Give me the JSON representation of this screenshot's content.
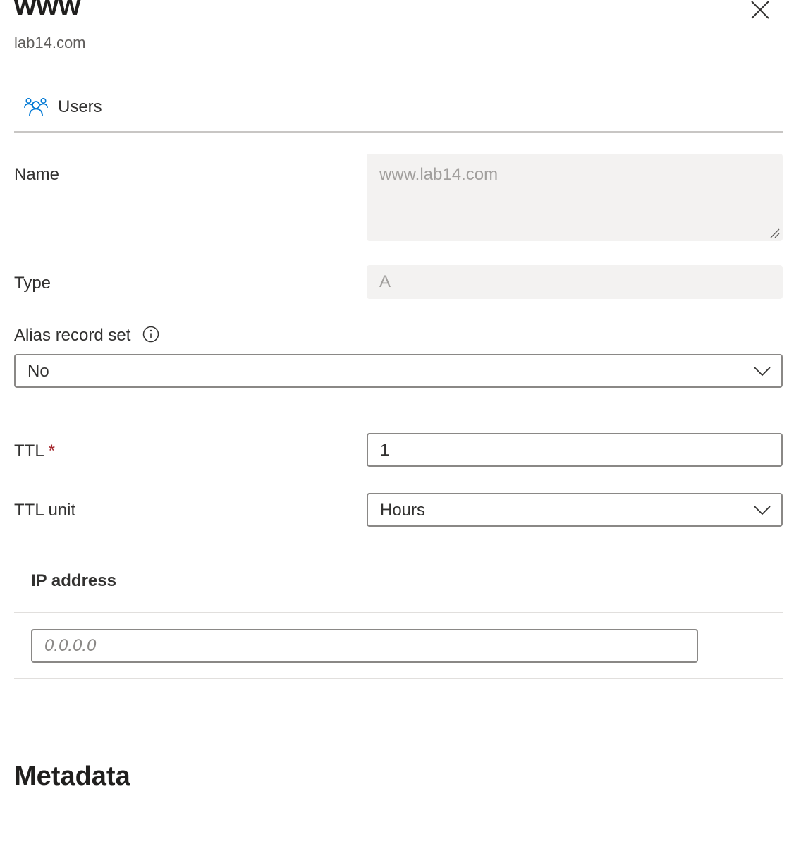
{
  "header": {
    "title": "www",
    "subtitle": "lab14.com",
    "close_icon": "close-icon"
  },
  "toolbar": {
    "users_label": "Users",
    "users_icon": "users-icon"
  },
  "form": {
    "name": {
      "label": "Name",
      "value": "www.lab14.com"
    },
    "type": {
      "label": "Type",
      "value": "A"
    },
    "alias": {
      "label": "Alias record set",
      "value": "No",
      "info_icon": "info-icon"
    },
    "ttl": {
      "label": "TTL",
      "required_mark": "*",
      "value": "1"
    },
    "ttl_unit": {
      "label": "TTL unit",
      "value": "Hours"
    }
  },
  "ip_table": {
    "header": "IP address",
    "placeholder": "0.0.0.0"
  },
  "metadata": {
    "title": "Metadata"
  },
  "colors": {
    "accent": "#0078d4",
    "required": "#a4262c",
    "disabled_bg": "#f3f2f1",
    "border": "#8a8886"
  }
}
